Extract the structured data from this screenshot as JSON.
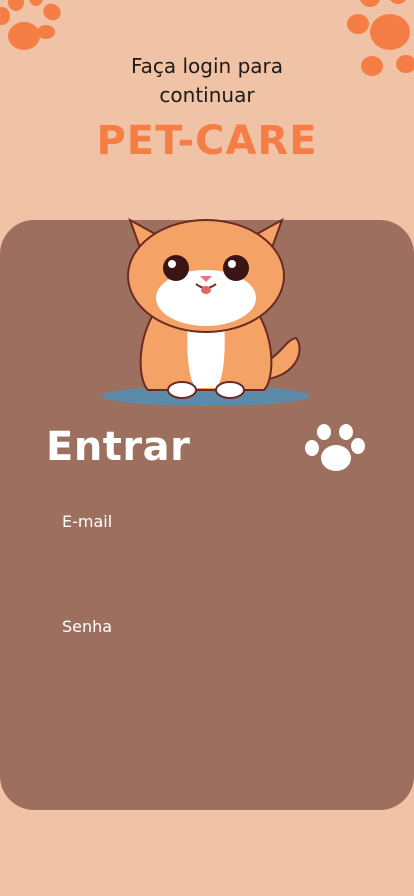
{
  "header": {
    "line1": "Faça login para",
    "line2": "continuar"
  },
  "brand": {
    "name": "PET-CARE"
  },
  "form": {
    "title": "Entrar",
    "email_label": "E-mail",
    "password_label": "Senha",
    "email_value": "",
    "password_value": ""
  },
  "icons": {
    "decoration": "paw-print-icon",
    "mascot": "cat-illustration",
    "form_icon": "paw-icon"
  },
  "colors": {
    "background": "#f0c2a6",
    "brand": "#f47e46",
    "card": "#9d6f5e",
    "text_light": "#ffffff",
    "text_dark": "#1f1a17"
  }
}
